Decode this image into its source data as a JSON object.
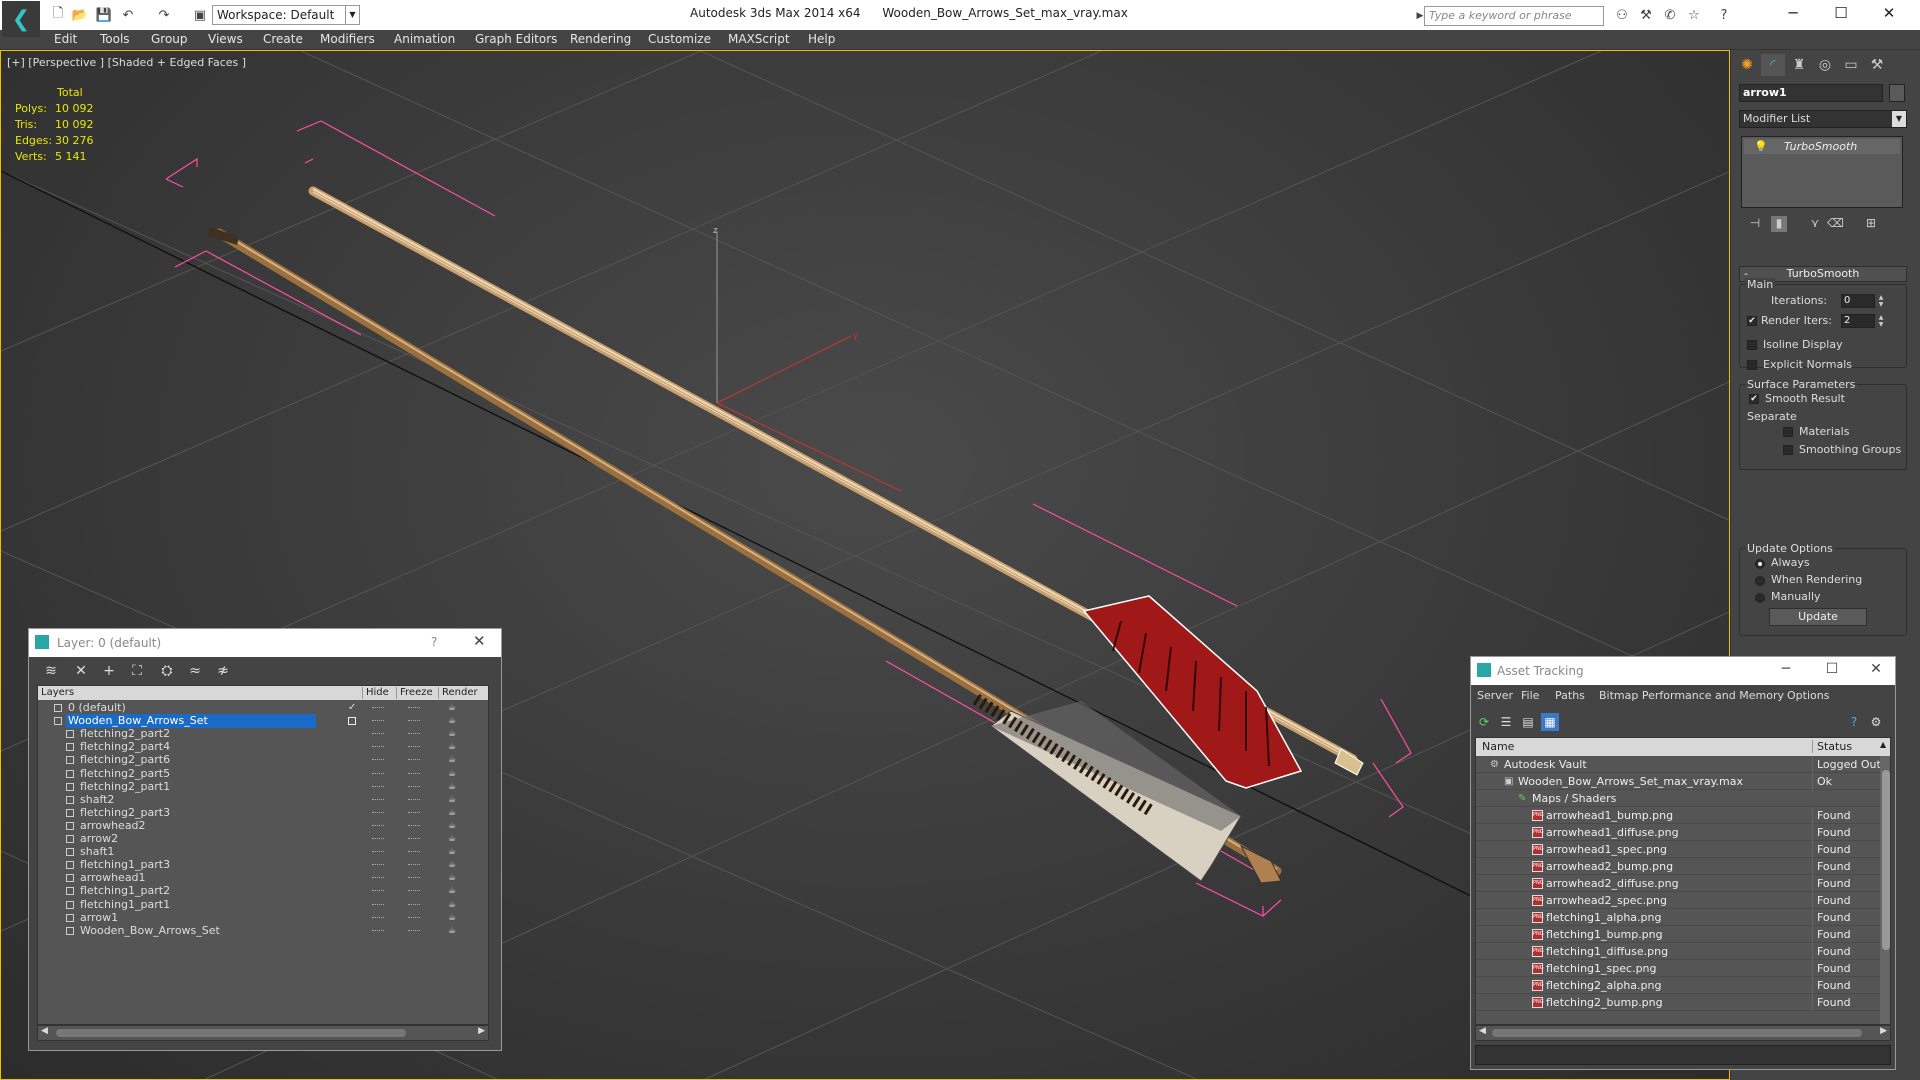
{
  "titlebar": {
    "workspace": "Workspace: Default",
    "app_title": "Autodesk 3ds Max  2014 x64",
    "file_name": "Wooden_Bow_Arrows_Set_max_vray.max",
    "search_placeholder": "Type a keyword or phrase"
  },
  "menu": [
    "Edit",
    "Tools",
    "Group",
    "Views",
    "Create",
    "Modifiers",
    "Animation",
    "Graph Editors",
    "Rendering",
    "Customize",
    "MAXScript",
    "Help"
  ],
  "viewport": {
    "label": "[+] [Perspective ] [Shaded + Edged Faces ]",
    "stats_header": "Total",
    "stats": [
      {
        "label": "Polys:",
        "value": "10 092"
      },
      {
        "label": "Tris:",
        "value": "10 092"
      },
      {
        "label": "Edges:",
        "value": "30 276"
      },
      {
        "label": "Verts:",
        "value": "5 141"
      }
    ],
    "axis_z": "z",
    "axis_y": "y"
  },
  "command_panel": {
    "object_name": "arrow1",
    "modifier_list": "Modifier List",
    "stack_item": "TurboSmooth",
    "rollout_title": "TurboSmooth",
    "main_label": "Main",
    "iterations_label": "Iterations:",
    "iterations_value": "0",
    "render_iters_label": "Render Iters:",
    "render_iters_value": "2",
    "isoline": "Isoline Display",
    "explicit_normals": "Explicit Normals",
    "surface_params": "Surface Parameters",
    "smooth_result": "Smooth Result",
    "separate": "Separate",
    "materials": "Materials",
    "smoothing_groups": "Smoothing Groups",
    "update_options": "Update Options",
    "always": "Always",
    "when_rendering": "When Rendering",
    "manually": "Manually",
    "update_button": "Update"
  },
  "layer_dialog": {
    "title": "Layer: 0 (default)",
    "help": "?",
    "col_layers": "Layers",
    "col_hide": "Hide",
    "col_freeze": "Freeze",
    "col_render": "Render",
    "rows": [
      {
        "name": "0 (default)",
        "indent": 1
      },
      {
        "name": "Wooden_Bow_Arrows_Set",
        "indent": 1
      },
      {
        "name": "fletching2_part2",
        "indent": 2
      },
      {
        "name": "fletching2_part4",
        "indent": 2
      },
      {
        "name": "fletching2_part6",
        "indent": 2
      },
      {
        "name": "fletching2_part5",
        "indent": 2
      },
      {
        "name": "fletching2_part1",
        "indent": 2
      },
      {
        "name": "shaft2",
        "indent": 2
      },
      {
        "name": "fletching2_part3",
        "indent": 2
      },
      {
        "name": "arrowhead2",
        "indent": 2
      },
      {
        "name": "arrow2",
        "indent": 2
      },
      {
        "name": "shaft1",
        "indent": 2
      },
      {
        "name": "fletching1_part3",
        "indent": 2
      },
      {
        "name": "arrowhead1",
        "indent": 2
      },
      {
        "name": "fletching1_part2",
        "indent": 2
      },
      {
        "name": "fletching1_part1",
        "indent": 2
      },
      {
        "name": "arrow1",
        "indent": 2
      },
      {
        "name": "Wooden_Bow_Arrows_Set",
        "indent": 2
      }
    ]
  },
  "asset_dialog": {
    "title": "Asset Tracking",
    "menu": [
      "Server",
      "File",
      "Paths",
      "Bitmap Performance and Memory",
      "Options"
    ],
    "col_name": "Name",
    "col_status": "Status",
    "rows": [
      {
        "name": "Autodesk Vault",
        "status": "Logged Out",
        "indent": 0,
        "kind": "vault"
      },
      {
        "name": "Wooden_Bow_Arrows_Set_max_vray.max",
        "status": "Ok",
        "indent": 1,
        "kind": "max"
      },
      {
        "name": "Maps / Shaders",
        "status": "",
        "indent": 2,
        "kind": "maps"
      },
      {
        "name": "arrowhead1_bump.png",
        "status": "Found",
        "indent": 3,
        "kind": "png"
      },
      {
        "name": "arrowhead1_diffuse.png",
        "status": "Found",
        "indent": 3,
        "kind": "png"
      },
      {
        "name": "arrowhead1_spec.png",
        "status": "Found",
        "indent": 3,
        "kind": "png"
      },
      {
        "name": "arrowhead2_bump.png",
        "status": "Found",
        "indent": 3,
        "kind": "png"
      },
      {
        "name": "arrowhead2_diffuse.png",
        "status": "Found",
        "indent": 3,
        "kind": "png"
      },
      {
        "name": "arrowhead2_spec.png",
        "status": "Found",
        "indent": 3,
        "kind": "png"
      },
      {
        "name": "fletching1_alpha.png",
        "status": "Found",
        "indent": 3,
        "kind": "png"
      },
      {
        "name": "fletching1_bump.png",
        "status": "Found",
        "indent": 3,
        "kind": "png"
      },
      {
        "name": "fletching1_diffuse.png",
        "status": "Found",
        "indent": 3,
        "kind": "png"
      },
      {
        "name": "fletching1_spec.png",
        "status": "Found",
        "indent": 3,
        "kind": "png"
      },
      {
        "name": "fletching2_alpha.png",
        "status": "Found",
        "indent": 3,
        "kind": "png"
      },
      {
        "name": "fletching2_bump.png",
        "status": "Found",
        "indent": 3,
        "kind": "png"
      }
    ]
  },
  "colors": {
    "selection": "#1a6bc7",
    "viewport_border": "#f0c000",
    "stats_text": "#e8e800",
    "bbox": "#ff4da6"
  }
}
